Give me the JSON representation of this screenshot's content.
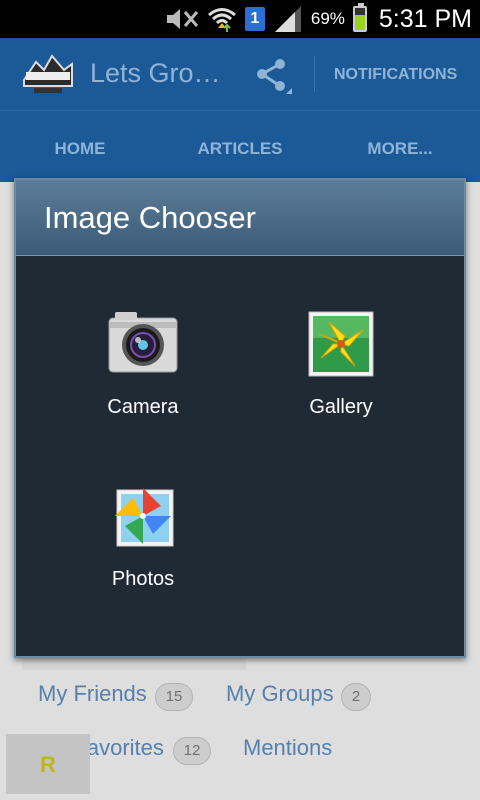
{
  "status_bar": {
    "battery_percent": "69%",
    "battery_level": 0.69,
    "sim_label": "1",
    "time": "5:31 PM",
    "icons": [
      "mute-icon",
      "wifi-icon",
      "sim-icon",
      "signal-icon",
      "battery-icon"
    ]
  },
  "action_bar": {
    "title": "Lets Gro…",
    "share_icon": "share-icon",
    "notifications_label": "NOTIFICATIONS",
    "color": "#1b5a96"
  },
  "tabs": [
    {
      "label": "HOME"
    },
    {
      "label": "ARTICLES"
    },
    {
      "label": "MORE..."
    }
  ],
  "dialog": {
    "title": "Image Chooser",
    "options": [
      {
        "label": "Camera",
        "icon": "camera-icon"
      },
      {
        "label": "Gallery",
        "icon": "gallery-icon"
      },
      {
        "label": "Photos",
        "icon": "photos-icon"
      }
    ]
  },
  "background": {
    "links": [
      {
        "label": "My Friends",
        "count": "15"
      },
      {
        "label": "My Groups",
        "count": "2"
      },
      {
        "label": "My Favorites",
        "count": "12"
      },
      {
        "label": "Mentions"
      }
    ],
    "fab_letter": "R"
  }
}
